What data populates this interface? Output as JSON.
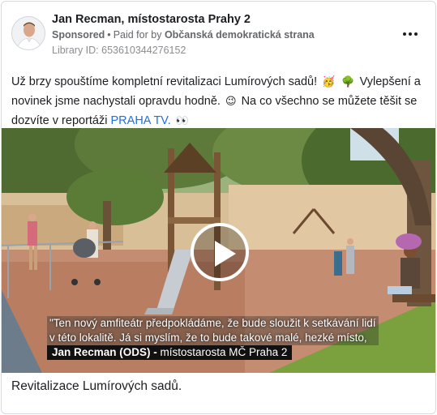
{
  "advertiser": {
    "name": "Jan Recman, místostarosta Prahy 2",
    "sponsored_label": "Sponsored",
    "separator": "•",
    "paid_for_prefix": "Paid for by",
    "payer": "Občanská demokratická strana",
    "library_id": "Library ID: 653610344276152"
  },
  "post": {
    "text_part1": "Už brzy spouštíme kompletní revitalizaci Lumírových sadů!",
    "text_part2": "Vylepšení a novinek jsme nachystali opravdu hodně.",
    "text_part3": "Na co všechno se můžete těšit se dozvíte v reportáži",
    "link_text": "PRAHA TV.",
    "emojis": {
      "e1": "🥳",
      "e2": "🌳",
      "e3": "😉",
      "e4": "👀"
    }
  },
  "video": {
    "subtitle_line1": "\"Ten nový amfiteátr předpokládáme, že bude sloužit k setkávání lidí",
    "subtitle_line2": "v této lokalitě. Já si myslím, že to bude takové malé, hezké místo,",
    "speaker_name": "Jan Recman (ODS) -",
    "speaker_role": " místostarosta MČ Praha 2"
  },
  "caption": "Revitalizace Lumírových sadů."
}
